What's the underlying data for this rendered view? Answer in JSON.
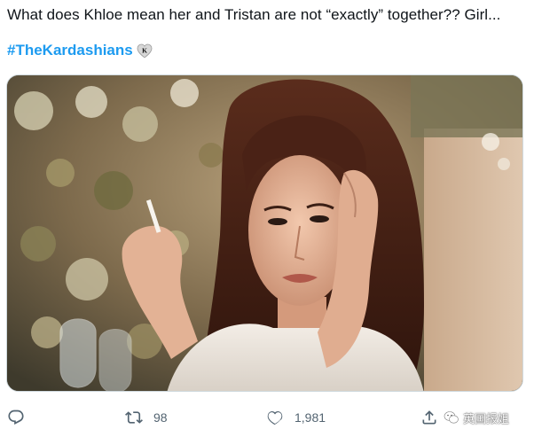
{
  "tweet": {
    "text": "What does Khloe mean her and Tristan are not “exactly” together?? Girl...",
    "hashtag": "#TheKardashians",
    "hashflag_icon": "kardashians-heart-k-icon"
  },
  "media": {
    "type": "photo",
    "icon": "photo-image"
  },
  "actions": {
    "reply_count": "",
    "retweet_count": "98",
    "like_count": "1,981",
    "reply_icon": "reply-icon",
    "retweet_icon": "retweet-icon",
    "like_icon": "heart-icon",
    "share_icon": "share-icon"
  },
  "watermark": {
    "text": "英国报姐",
    "icon": "wechat-logo-icon"
  },
  "colors": {
    "link": "#1d9bf0",
    "action_gray": "#536471",
    "text": "#0f1419"
  }
}
